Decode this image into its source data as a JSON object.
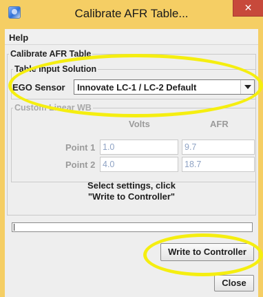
{
  "window": {
    "title": "Calibrate AFR Table...",
    "close_label": "✕"
  },
  "menu": {
    "help": "Help"
  },
  "dialog": {
    "group_title": "Calibrate AFR Table",
    "input_section": {
      "title": "Table Input Solution",
      "ego_label": "EGO Sensor",
      "ego_value": "Innovate LC-1 / LC-2 Default"
    },
    "custom_section": {
      "title": "Custom Linear WB",
      "col_volts": "Volts",
      "col_afr": "AFR",
      "rows": [
        {
          "label": "Point 1",
          "volts": "1.0",
          "afr": "9.7"
        },
        {
          "label": "Point 2",
          "volts": "4.0",
          "afr": "18.7"
        }
      ]
    },
    "instruction_line1": "Select settings, click",
    "instruction_line2": "\"Write to Controller\"",
    "progress": 0.0,
    "write_button": "Write to Controller",
    "close_button": "Close"
  },
  "colors": {
    "title_bar": "#f5ce64",
    "close_button_bg": "#c7493b",
    "highlight": "#f5ee10"
  }
}
